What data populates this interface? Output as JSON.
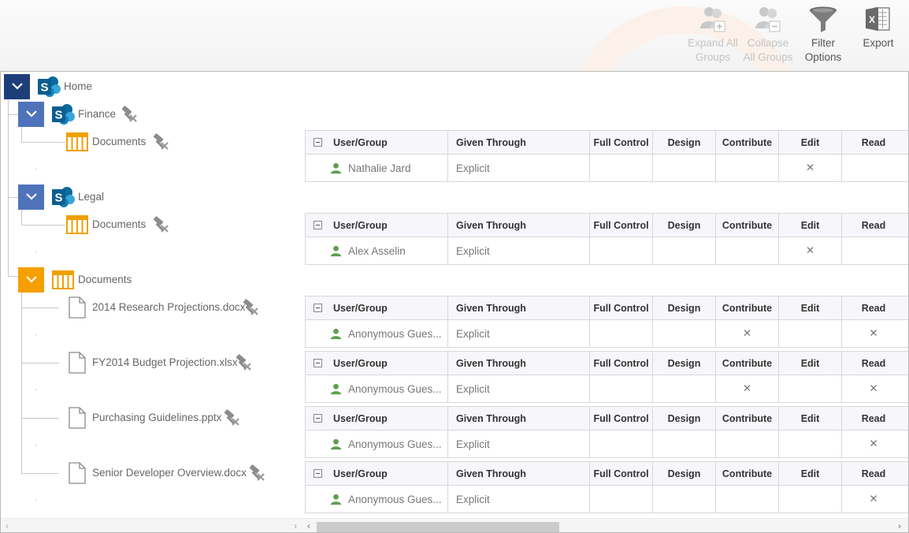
{
  "ribbon": {
    "expand_all": {
      "line1": "Expand All",
      "line2": "Groups"
    },
    "collapse_all": {
      "line1": "Collapse",
      "line2": "All Groups"
    },
    "filter": {
      "line1": "Filter",
      "line2": "Options"
    },
    "export": {
      "line1": "Export"
    }
  },
  "tree": {
    "home": "Home",
    "finance": "Finance",
    "finance_docs": "Documents",
    "legal": "Legal",
    "legal_docs": "Documents",
    "home_docs": "Documents",
    "files": [
      "2014 Research Projections.docx",
      "FY2014 Budget Projection.xlsx",
      "Purchasing Guidelines.pptx",
      "Senior Developer Overview.docx"
    ]
  },
  "grid_headers": {
    "user_group": "User/Group",
    "given_through": "Given Through",
    "full_control": "Full Control",
    "design": "Design",
    "contribute": "Contribute",
    "edit": "Edit",
    "read": "Read"
  },
  "grids": [
    {
      "user": "Nathalie Jard",
      "given": "Explicit",
      "full_control": "",
      "design": "",
      "contribute": "",
      "edit": "✕",
      "read": ""
    },
    {
      "user": "Alex Asselin",
      "given": "Explicit",
      "full_control": "",
      "design": "",
      "contribute": "",
      "edit": "✕",
      "read": ""
    },
    {
      "user": "Anonymous Gues...",
      "given": "Explicit",
      "full_control": "",
      "design": "",
      "contribute": "✕",
      "edit": "",
      "read": "✕"
    },
    {
      "user": "Anonymous Gues...",
      "given": "Explicit",
      "full_control": "",
      "design": "",
      "contribute": "✕",
      "edit": "",
      "read": "✕"
    },
    {
      "user": "Anonymous Gues...",
      "given": "Explicit",
      "full_control": "",
      "design": "",
      "contribute": "",
      "edit": "",
      "read": "✕"
    },
    {
      "user": "Anonymous Gues...",
      "given": "Explicit",
      "full_control": "",
      "design": "",
      "contribute": "",
      "edit": "",
      "read": "✕"
    }
  ],
  "colors": {
    "navy": "#1e3e79",
    "blue": "#4f73bb",
    "orange": "#f59f00",
    "sharepoint": "#0b6a9e",
    "user_green": "#5e9d4f"
  }
}
